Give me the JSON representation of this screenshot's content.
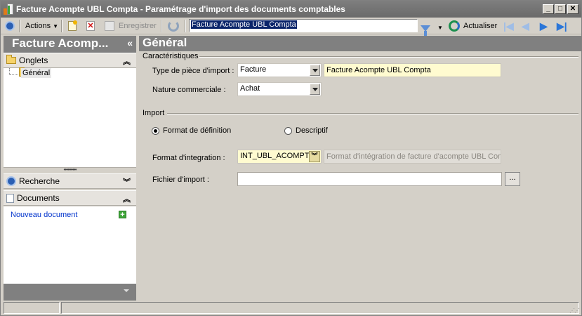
{
  "window": {
    "title": "Facture Acompte UBL Compta - Paramétrage d'import des documents comptables",
    "minimize": "_",
    "maximize": "□",
    "close": "✕"
  },
  "toolbar": {
    "actions_label": "Actions",
    "save_label": "Enregistrer",
    "search_value": "Facture Acompte UBL Compta",
    "refresh_label": "Actualiser"
  },
  "left": {
    "header": "Facture Acomp...",
    "collapse_glyph": "«",
    "tabs_section": "Onglets",
    "tree_items": [
      {
        "label": "Général"
      }
    ],
    "search_section": "Recherche",
    "documents_section": "Documents",
    "new_document": "Nouveau document"
  },
  "main": {
    "header": "Général",
    "characteristics": {
      "title": "Caractéristiques",
      "doc_type_label": "Type de pièce d'import :",
      "doc_type_value": "Facture",
      "doc_type_desc": "Facture Acompte UBL Compta",
      "nature_label": "Nature commerciale :",
      "nature_value": "Achat"
    },
    "import": {
      "title": "Import",
      "radio_definition": "Format de définition",
      "radio_descriptive": "Descriptif",
      "selected": "definition",
      "integration_label": "Format d'integration :",
      "integration_value": "INT_UBL_ACOMPTE",
      "integration_desc": "Format d'intégration de facture d'acompte UBL Compta",
      "file_label": "Fichier d'import :",
      "file_value": "",
      "browse_label": "..."
    }
  },
  "colors": {
    "header_bg": "#808080",
    "field_readonly_bg": "#fffbd0",
    "link": "#0033cc"
  }
}
